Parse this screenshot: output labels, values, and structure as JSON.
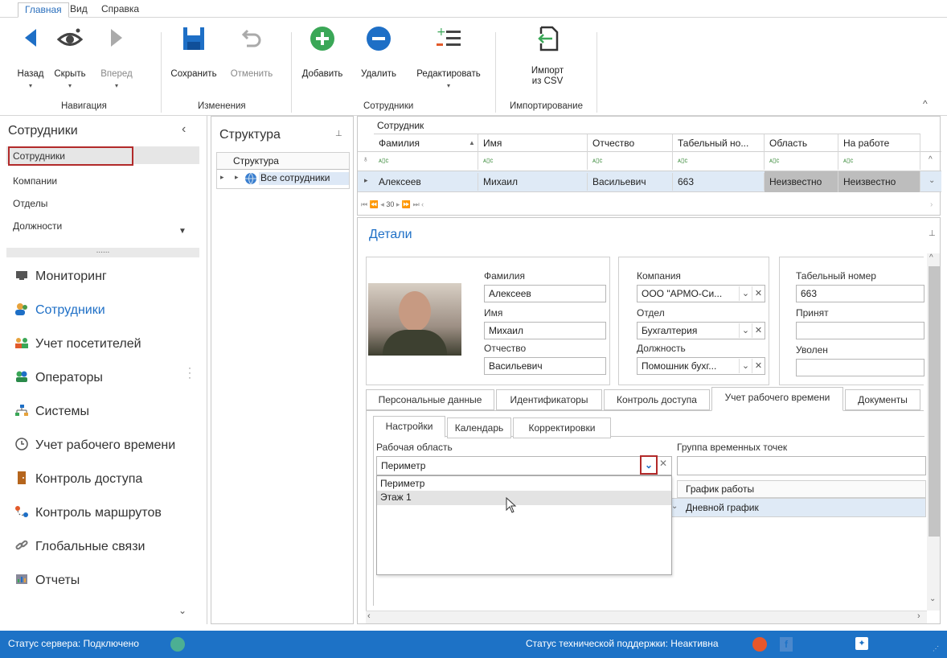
{
  "ribbon": {
    "tabs": [
      "Главная",
      "Вид",
      "Справка"
    ],
    "buttons": {
      "back": "Назад",
      "hide": "Скрыть",
      "forward": "Вперед",
      "save": "Сохранить",
      "undo": "Отменить",
      "add": "Добавить",
      "delete": "Удалить",
      "edit": "Редактировать",
      "import_line1": "Импорт",
      "import_line2": "из CSV"
    },
    "groups": {
      "navigation": "Навигация",
      "changes": "Изменения",
      "employees": "Сотрудники",
      "import": "Импортирование"
    },
    "accent": "#2a6fbd"
  },
  "left_panel": {
    "title": "Сотрудники",
    "items": [
      "Сотрудники",
      "Компании",
      "Отделы",
      "Должности"
    ],
    "dots": "......",
    "nav": [
      {
        "label": "Мониторинг",
        "icon": "monitor-icon"
      },
      {
        "label": "Сотрудники",
        "icon": "employees-icon"
      },
      {
        "label": "Учет посетителей",
        "icon": "visitors-icon"
      },
      {
        "label": "Операторы",
        "icon": "operators-icon"
      },
      {
        "label": "Системы",
        "icon": "systems-icon"
      },
      {
        "label": "Учет рабочего времени",
        "icon": "clock-icon"
      },
      {
        "label": "Контроль доступа",
        "icon": "door-icon"
      },
      {
        "label": "Контроль маршрутов",
        "icon": "route-icon"
      },
      {
        "label": "Глобальные связи",
        "icon": "link-icon"
      },
      {
        "label": "Отчеты",
        "icon": "report-icon"
      }
    ]
  },
  "structure": {
    "title": "Структура",
    "header": "Структура",
    "node": "Все сотрудники"
  },
  "grid": {
    "group_header": "Сотрудник",
    "columns": [
      "Фамилия",
      "Имя",
      "Отчество",
      "Табельный но...",
      "Область",
      "На работе"
    ],
    "filter_glyph": "ᴀ▯c",
    "rows": [
      [
        "Алексеев",
        "Михаил",
        "Васильевич",
        "663",
        "Неизвестно",
        "Неизвестно"
      ]
    ],
    "pager": "30"
  },
  "details": {
    "title": "Детали",
    "labels": {
      "last_name": "Фамилия",
      "first_name": "Имя",
      "middle_name": "Отчество",
      "company": "Компания",
      "department": "Отдел",
      "position": "Должность",
      "tab_number": "Табельный номер",
      "hired": "Принят",
      "fired": "Уволен"
    },
    "values": {
      "last_name": "Алексеев",
      "first_name": "Михаил",
      "middle_name": "Васильевич",
      "company": "ООО \"АРМО-Си...",
      "department": "Бухгалтерия",
      "position": "Помошник бухг...",
      "tab_number": "663",
      "hired": "",
      "fired": ""
    },
    "tabs": [
      "Персональные данные",
      "Идентификаторы",
      "Контроль доступа",
      "Учет рабочего времени",
      "Документы"
    ],
    "subtabs": [
      "Настройки",
      "Календарь",
      "Корректировки"
    ],
    "work_area_label": "Рабочая область",
    "work_area_value": "Периметр",
    "time_points_label": "Группа временных точек",
    "dropdown_options": [
      "Периметр",
      "Этаж 1"
    ],
    "schedule_header": "График работы",
    "schedule_value": "Дневной график"
  },
  "status": {
    "server": "Статус сервера: Подключено",
    "support": "Статус технической поддержки: Неактивна",
    "server_color": "#4caf93",
    "support_color": "#e8572a"
  }
}
